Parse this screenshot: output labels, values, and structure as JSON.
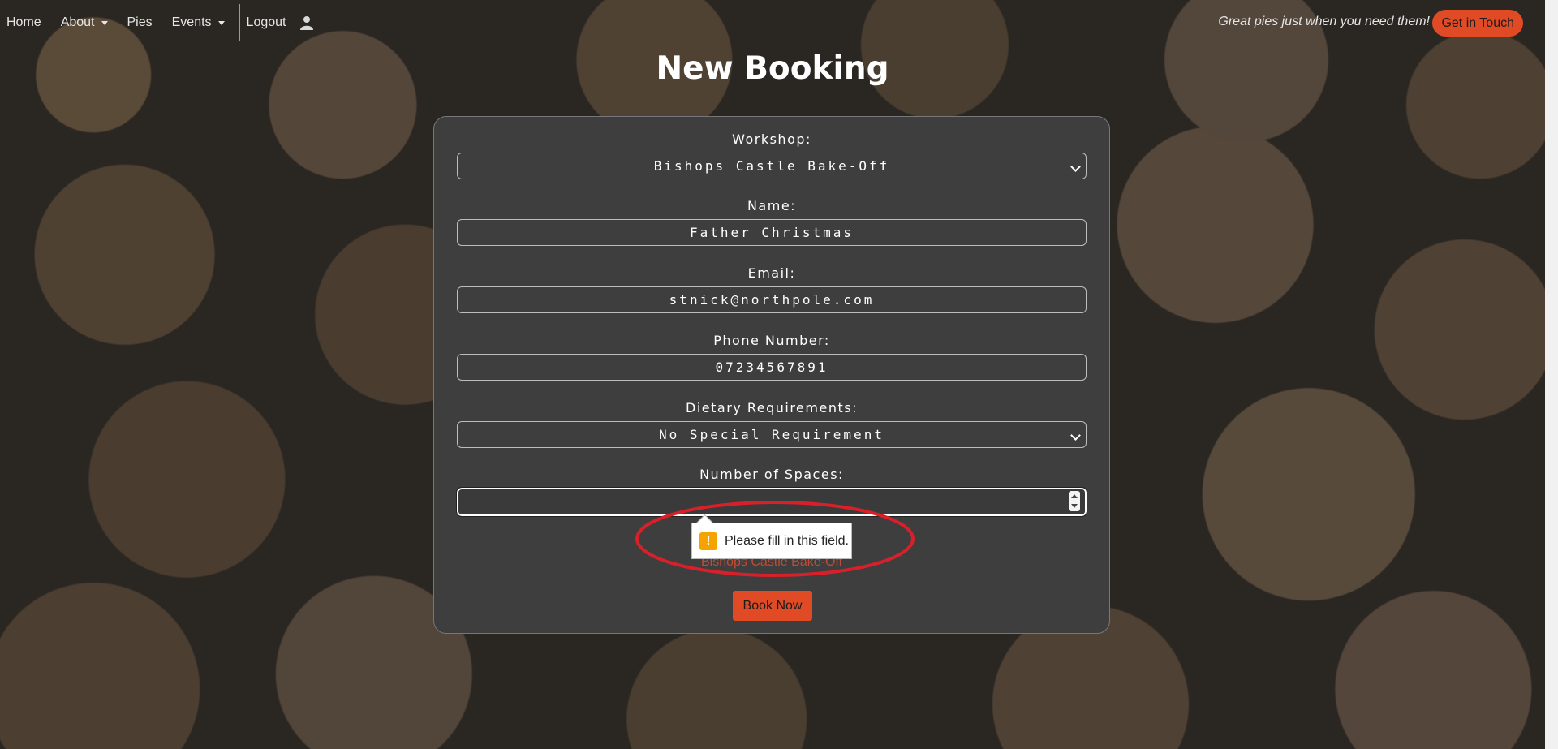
{
  "nav": {
    "items": [
      {
        "label": "Home",
        "dropdown": false
      },
      {
        "label": "About",
        "dropdown": true
      },
      {
        "label": "Pies",
        "dropdown": false
      },
      {
        "label": "Events",
        "dropdown": true
      },
      {
        "label": "Logout",
        "dropdown": false
      }
    ],
    "user_icon": "user-icon",
    "tagline": "Great pies just when you need them!",
    "cta_label": "Get in Touch"
  },
  "page": {
    "title": "New Booking"
  },
  "form": {
    "workshop": {
      "label": "Workshop:",
      "value": "Bishops Castle Bake-Off"
    },
    "name": {
      "label": "Name:",
      "value": "Father Christmas"
    },
    "email": {
      "label": "Email:",
      "value": "stnick@northpole.com"
    },
    "phone": {
      "label": "Phone Number:",
      "value": "07234567891"
    },
    "dietary": {
      "label": "Dietary Requirements:",
      "value": "No Special Requirement"
    },
    "spaces": {
      "label": "Number of Spaces:",
      "value": ""
    },
    "workshop_echo": "Bishops Castle Bake-Off",
    "submit_label": "Book Now"
  },
  "validation": {
    "message": "Please fill in this field.",
    "icon": "warning-icon"
  },
  "colors": {
    "accent": "#e04a24",
    "annotation": "#d8202a",
    "card": "#3e3e3e"
  }
}
